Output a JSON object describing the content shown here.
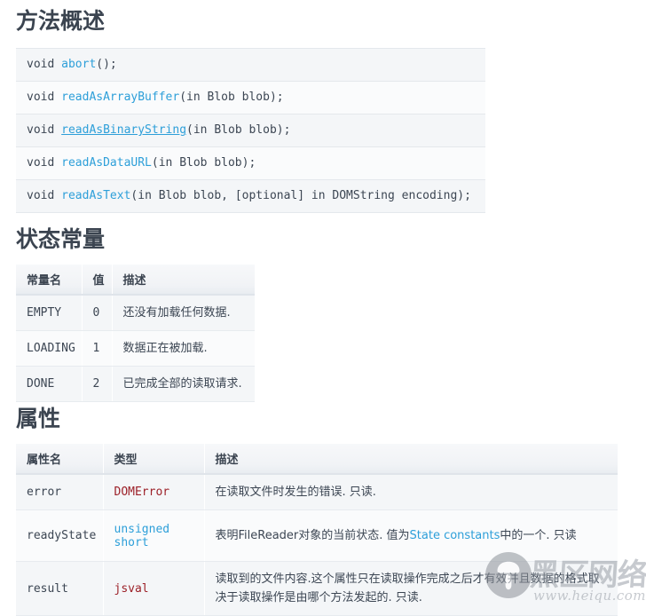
{
  "sections": {
    "methods": {
      "title": "方法概述",
      "lines": [
        {
          "ret": "void ",
          "name": "abort",
          "name_link": true,
          "underline": false,
          "rest": "();"
        },
        {
          "ret": "void ",
          "name": "readAsArrayBuffer",
          "name_link": true,
          "underline": false,
          "rest": "(in Blob blob);"
        },
        {
          "ret": "void ",
          "name": "readAsBinaryString",
          "name_link": true,
          "underline": true,
          "rest": "(in Blob blob);"
        },
        {
          "ret": "void ",
          "name": "readAsDataURL",
          "name_link": true,
          "underline": false,
          "rest": "(in Blob blob);"
        },
        {
          "ret": "void ",
          "name": "readAsText",
          "name_link": true,
          "underline": false,
          "rest": "(in Blob blob, [optional] in DOMString encoding);"
        }
      ]
    },
    "states": {
      "title": "状态常量",
      "headers": [
        "常量名",
        "值",
        "描述"
      ],
      "rows": [
        {
          "name": "EMPTY",
          "value": "0",
          "desc": "还没有加载任何数据."
        },
        {
          "name": "LOADING",
          "value": "1",
          "desc": "数据正在被加载."
        },
        {
          "name": "DONE",
          "value": "2",
          "desc": "已完成全部的读取请求."
        }
      ]
    },
    "properties": {
      "title": "属性",
      "headers": [
        "属性名",
        "类型",
        "描述"
      ],
      "rows": [
        {
          "name": "error",
          "type": "DOMError",
          "type_style": "red",
          "desc_pre": "在读取文件时发生的错误. 只读.",
          "desc_link": "",
          "desc_post": ""
        },
        {
          "name": "readyState",
          "type": "unsigned short",
          "type_style": "blue",
          "desc_pre": "表明FileReader对象的当前状态. 值为",
          "desc_link": "State constants",
          "desc_post": "中的一个. 只读"
        },
        {
          "name": "result",
          "type": "jsval",
          "type_style": "red",
          "desc_pre": "读取到的文件内容.这个属性只在读取操作完成之后才有效并且数据的格式取决于读取操作是由哪个方法发起的. 只读.",
          "desc_link": "",
          "desc_post": ""
        }
      ]
    }
  },
  "watermark": {
    "brand": "黑区网络",
    "url": "www.heiqu.com",
    "logo_icon": "mushroom-logo-icon"
  },
  "colors": {
    "link": "#2d9fd9",
    "type_red": "#9c2028",
    "heading": "#3b4450",
    "row_bg": "#f4f6f8",
    "row_bg_alt": "#fafbfc",
    "border": "#e4e8ec"
  }
}
